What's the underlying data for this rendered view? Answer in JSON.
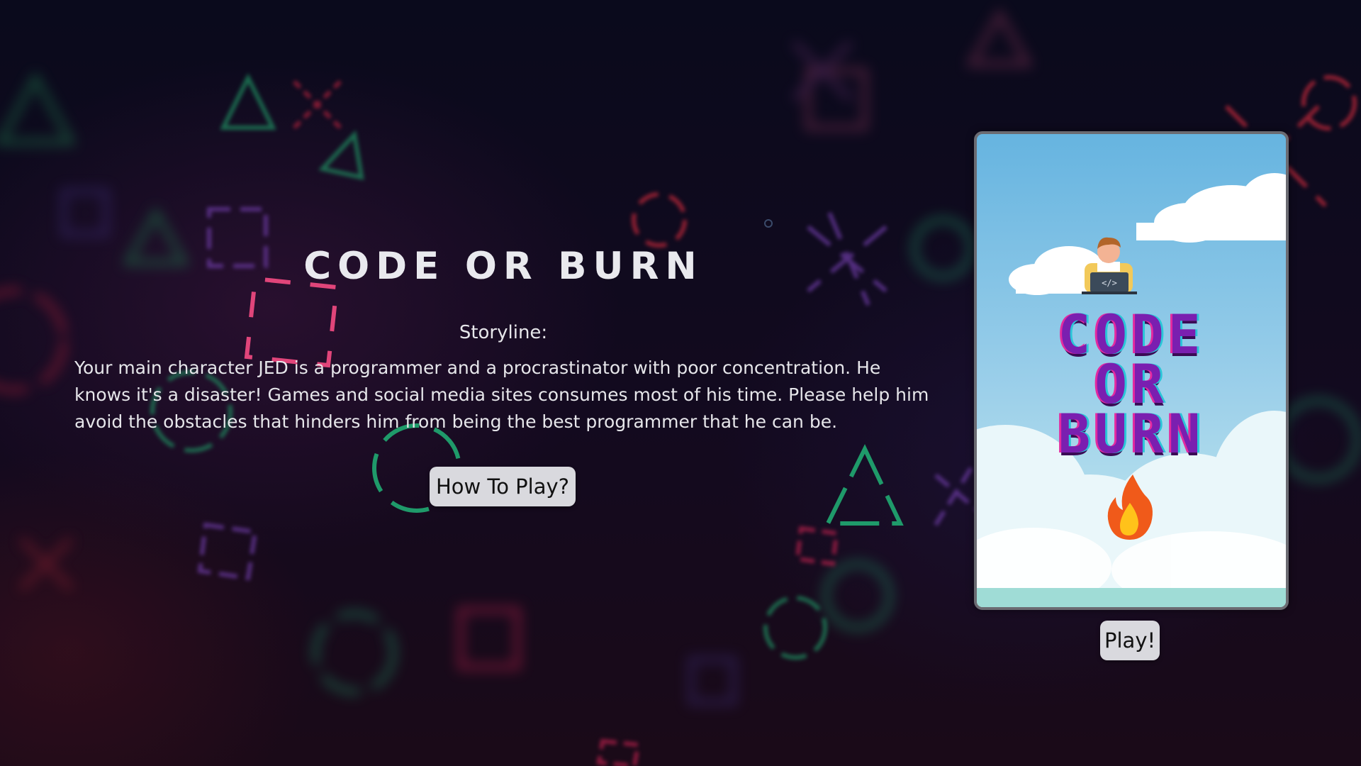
{
  "game": {
    "title": "CODE OR BURN",
    "storyline_label": "Storyline:",
    "storyline_text": "Your main character JED is a programmer and a procrastinator with poor concentration. He knows it's a disaster! Games and social media sites consumes most of his time. Please help him avoid the obstacles that hinders him from being the best programmer that he can be.",
    "how_to_play_label": "How To Play?",
    "play_label": "Play!"
  },
  "cover": {
    "logo_lines": [
      "CODE",
      "OR",
      "BURN"
    ],
    "character_icon": "programmer-at-laptop-icon",
    "flame_icon": "fire-icon"
  },
  "colors": {
    "background": "#0d0818",
    "neon_pink": "#e0457a",
    "neon_green": "#1f9a6a",
    "neon_purple": "#7a3fb0",
    "neon_red": "#c2283a",
    "button_bg": "#d9d9de",
    "logo_purple": "#7a1fb0"
  }
}
